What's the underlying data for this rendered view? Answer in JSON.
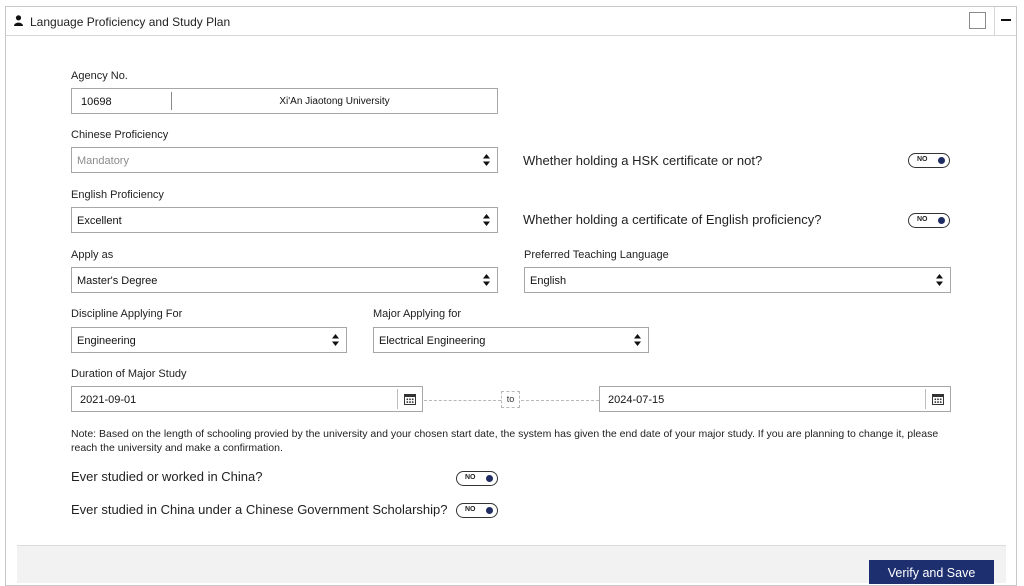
{
  "panel": {
    "title": "Language Proficiency and Study Plan"
  },
  "agency": {
    "label": "Agency No.",
    "code": "10698",
    "university": "Xi'An Jiaotong University"
  },
  "chinese_proficiency": {
    "label": "Chinese Proficiency",
    "value": "Mandatory"
  },
  "hsk": {
    "question": "Whether holding a HSK certificate or not?",
    "toggle": "NO"
  },
  "english_proficiency": {
    "label": "English Proficiency",
    "value": "Excellent"
  },
  "english_cert": {
    "question": "Whether holding a certificate of English proficiency?",
    "toggle": "NO"
  },
  "apply_as": {
    "label": "Apply as",
    "value": "Master's Degree"
  },
  "teaching_language": {
    "label": "Preferred Teaching Language",
    "value": "English"
  },
  "discipline": {
    "label": "Discipline Applying For",
    "value": "Engineering"
  },
  "major": {
    "label": "Major Applying for",
    "value": "Electrical Engineering"
  },
  "duration": {
    "label": "Duration of Major Study",
    "start": "2021-09-01",
    "to": "to",
    "end": "2024-07-15"
  },
  "note": "Note: Based on the length of schooling provied by the university and your chosen start date, the system has given the end date of your major study. If you are planning to change it, please reach the university and make a confirmation.",
  "studied_china": {
    "question": "Ever studied or worked in China?",
    "toggle": "NO"
  },
  "csc_scholarship": {
    "question": "Ever studied in China under a Chinese Government Scholarship?",
    "toggle": "NO"
  },
  "footer": {
    "verify_save": "Verify and Save"
  },
  "colors": {
    "primary": "#1d2f6f",
    "knob": "#1f2d63",
    "border": "#a7a7a7"
  },
  "icons": [
    "person-icon",
    "select-arrows-icon",
    "calendar-icon",
    "minus-icon"
  ]
}
